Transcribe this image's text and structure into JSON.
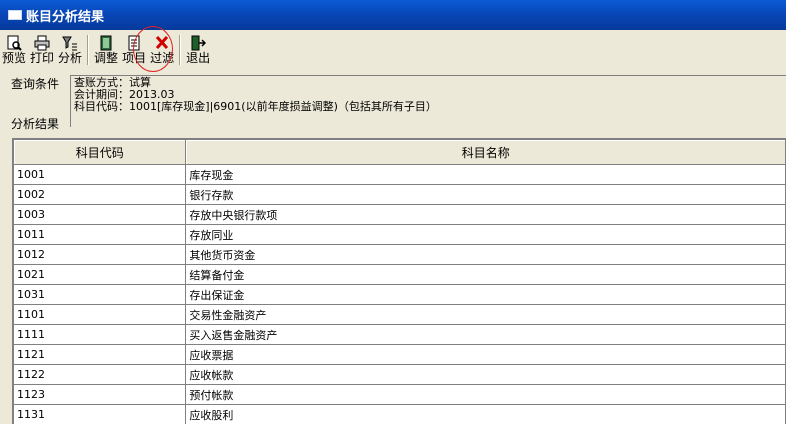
{
  "window": {
    "title": "账目分析结果"
  },
  "toolbar": {
    "buttons": [
      {
        "label": "预览",
        "icon": "preview-icon"
      },
      {
        "label": "打印",
        "icon": "print-icon"
      },
      {
        "label": "分析",
        "icon": "analyze-icon"
      },
      {
        "label": "调整",
        "icon": "adjust-icon"
      },
      {
        "label": "项目",
        "icon": "project-icon"
      },
      {
        "label": "过滤",
        "icon": "filter-icon"
      },
      {
        "label": "退出",
        "icon": "exit-icon"
      }
    ]
  },
  "query": {
    "condition_label": "查询条件",
    "result_label": "分析结果",
    "lines": [
      "查账方式：试算",
      "会计期间：2013.03",
      "科目代码：1001[库存现金]|6901(以前年度损益调整)（包括其所有子目）"
    ]
  },
  "table": {
    "columns": [
      "科目代码",
      "科目名称"
    ],
    "rows": [
      [
        "1001",
        "库存现金"
      ],
      [
        "1002",
        "银行存款"
      ],
      [
        "1003",
        "存放中央银行款项"
      ],
      [
        "1011",
        "存放同业"
      ],
      [
        "1012",
        "其他货币资金"
      ],
      [
        "1021",
        "结算备付金"
      ],
      [
        "1031",
        "存出保证金"
      ],
      [
        "1101",
        "交易性金融资产"
      ],
      [
        "1111",
        "买入返售金融资产"
      ],
      [
        "1121",
        "应收票据"
      ],
      [
        "1122",
        "应收帐款"
      ],
      [
        "1123",
        "预付帐款"
      ],
      [
        "1131",
        "应收股利"
      ]
    ]
  },
  "colors": {
    "titlebar": "#0a5bd6",
    "highlight": "#e02020",
    "background": "#ece9d8"
  }
}
